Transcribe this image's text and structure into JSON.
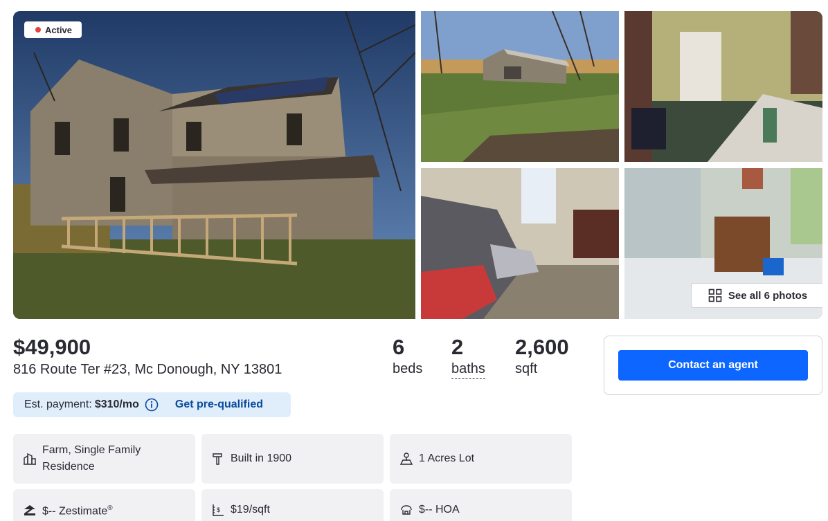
{
  "gallery": {
    "status_badge": "Active",
    "see_all_label": "See all 6 photos"
  },
  "listing": {
    "price": "$49,900",
    "address": "816 Route Ter #23, Mc Donough, NY 13801",
    "beds_value": "6",
    "beds_label": "beds",
    "baths_value": "2",
    "baths_label": "baths",
    "sqft_value": "2,600",
    "sqft_label": "sqft"
  },
  "contact": {
    "button_label": "Contact an agent"
  },
  "payment": {
    "label": "Est. payment:",
    "amount": "$310/mo",
    "prequal_label": "Get pre-qualified"
  },
  "facts": [
    {
      "icon": "building-icon",
      "text": "Farm, Single Family Residence"
    },
    {
      "icon": "hammer-icon",
      "text": "Built in 1900"
    },
    {
      "icon": "lot-size-icon",
      "text": "1 Acres Lot"
    },
    {
      "icon": "zestimate-icon",
      "text": "$-- Zestimate",
      "sup": "®"
    },
    {
      "icon": "price-per-sqft-icon",
      "text": "$19/sqft"
    },
    {
      "icon": "hoa-icon",
      "text": "$-- HOA"
    }
  ],
  "colors": {
    "accent": "#0d66ff",
    "status_dot": "#e8423f",
    "payment_bg": "#e0eefc",
    "tile_bg": "#f1f1f4"
  }
}
